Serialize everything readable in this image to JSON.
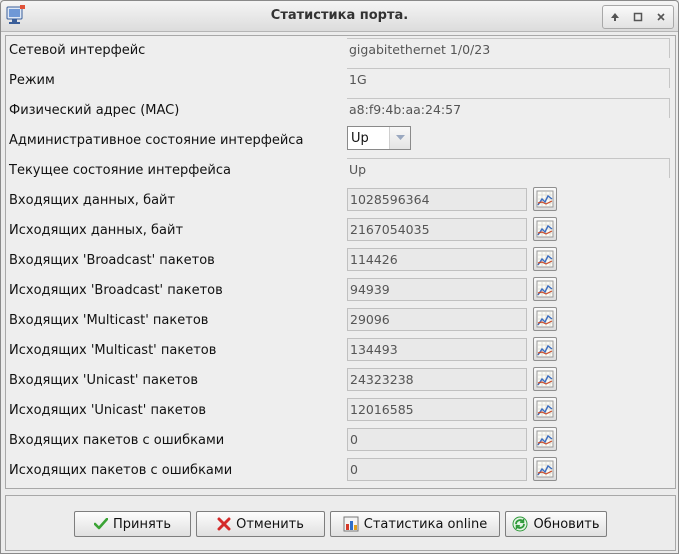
{
  "window": {
    "title": "Статистика порта."
  },
  "fields": [
    {
      "label": "Сетевой интерфейс",
      "value": "gigabitethernet 1/0/23"
    },
    {
      "label": "Режим",
      "value": "1G"
    },
    {
      "label": "Физический адрес (MAC)",
      "value": "a8:f9:4b:aa:24:57"
    },
    {
      "label": "Административное состояние интерфейса",
      "value": "Up"
    },
    {
      "label": "Текущее состояние интерфейса",
      "value": "Up"
    }
  ],
  "counters": [
    {
      "label": "Входящих данных, байт",
      "value": "1028596364"
    },
    {
      "label": "Исходящих данных, байт",
      "value": "2167054035"
    },
    {
      "label": "Входящих 'Broadcast' пакетов",
      "value": "114426"
    },
    {
      "label": "Исходящих 'Broadcast' пакетов",
      "value": "94939"
    },
    {
      "label": "Входящих 'Multicast' пакетов",
      "value": "29096"
    },
    {
      "label": "Исходящих 'Multicast' пакетов",
      "value": "134493"
    },
    {
      "label": "Входящих 'Unicast' пакетов",
      "value": "24323238"
    },
    {
      "label": "Исходящих 'Unicast' пакетов",
      "value": "12016585"
    },
    {
      "label": "Входящих пакетов с ошибками",
      "value": "0"
    },
    {
      "label": "Исходящих пакетов с ошибками",
      "value": "0"
    }
  ],
  "buttons": {
    "accept": "Принять",
    "cancel": "Отменить",
    "stats_online": "Статистика online",
    "refresh": "Обновить"
  },
  "colors": {
    "accept_check": "#3aa335",
    "cancel_x": "#d42a2a",
    "refresh": "#2f9a3a"
  }
}
